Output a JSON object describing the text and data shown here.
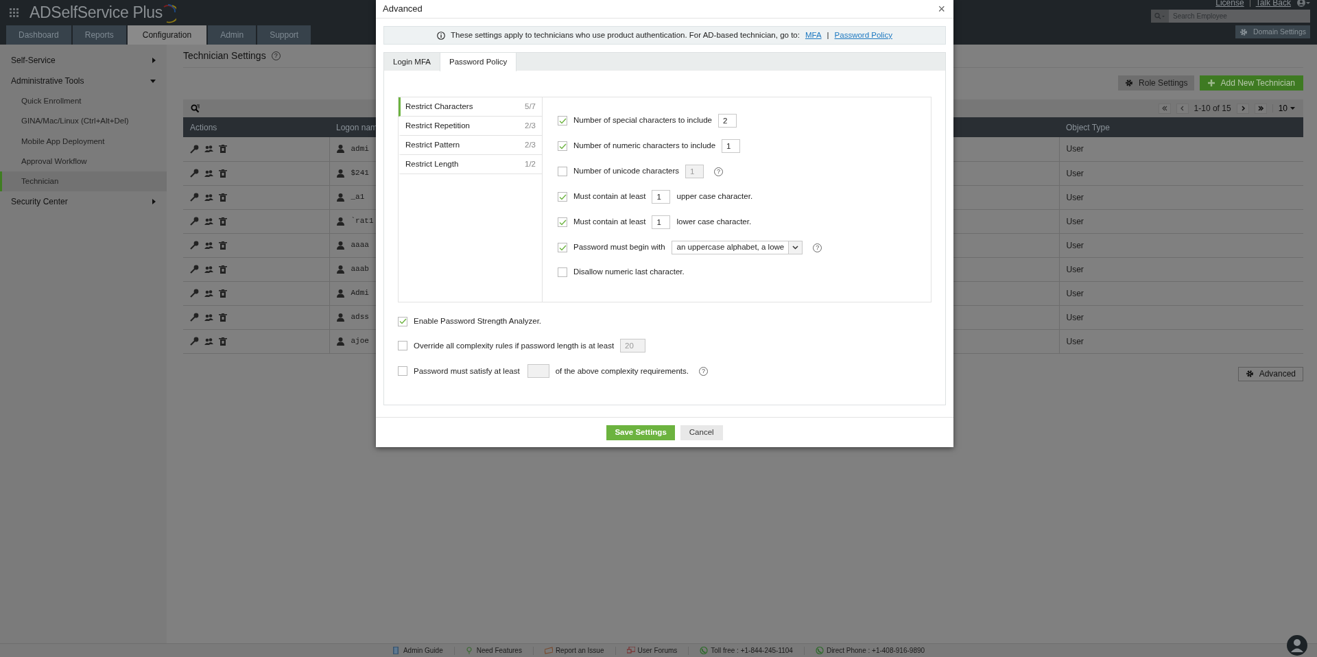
{
  "app": {
    "title": "ADSelfService Plus"
  },
  "header_links": [
    "License",
    "Talk Back"
  ],
  "search": {
    "placeholder": "Search Employee"
  },
  "domain_button": "Domain Settings",
  "main_tabs": [
    {
      "label": "Dashboard",
      "selected": false
    },
    {
      "label": "Reports",
      "selected": false
    },
    {
      "label": "Configuration",
      "selected": true
    },
    {
      "label": "Admin",
      "selected": false
    },
    {
      "label": "Support",
      "selected": false
    }
  ],
  "sidebar": {
    "items": [
      {
        "label": "Self-Service",
        "expanded": false
      },
      {
        "label": "Administrative Tools",
        "expanded": true,
        "children": [
          {
            "label": "Quick Enrollment",
            "selected": false
          },
          {
            "label": "GINA/Mac/Linux (Ctrl+Alt+Del)",
            "selected": false
          },
          {
            "label": "Mobile App Deployment",
            "selected": false
          },
          {
            "label": "Approval Workflow",
            "selected": false
          },
          {
            "label": "Technician",
            "selected": true
          }
        ]
      },
      {
        "label": "Security Center",
        "expanded": false
      }
    ]
  },
  "page": {
    "title": "Technician Settings",
    "help": "?",
    "buttons": [
      {
        "label": "Role Settings",
        "kind": "secondary"
      },
      {
        "label": "Add New Technician",
        "kind": "primary"
      }
    ]
  },
  "pagination": {
    "range": "1-10 of 15",
    "page_size": "10"
  },
  "table": {
    "columns": [
      "Actions",
      "Logon nam",
      "Object Type"
    ],
    "rows": [
      {
        "logon": "admi",
        "object_type": "User"
      },
      {
        "logon": "$241",
        "object_type": "User"
      },
      {
        "logon": "_a1",
        "object_type": "User"
      },
      {
        "logon": "`rat1",
        "object_type": "User"
      },
      {
        "logon": "aaaa",
        "object_type": "User"
      },
      {
        "logon": "aaab",
        "object_type": "User"
      },
      {
        "logon": "Admi",
        "object_type": "User"
      },
      {
        "logon": "adss",
        "object_type": "User"
      },
      {
        "logon": "ajoe",
        "object_type": "User"
      }
    ]
  },
  "advanced_button": "Advanced",
  "footer": [
    {
      "label": "Admin Guide",
      "kind": "guide"
    },
    {
      "label": "Need Features",
      "kind": "idea"
    },
    {
      "label": "Report an Issue",
      "kind": "issue"
    },
    {
      "label": "User Forums",
      "kind": "forum"
    },
    {
      "label": "Toll free : +1-844-245-1104",
      "kind": "phone"
    },
    {
      "label": "Direct Phone : +1-408-916-9890",
      "kind": "phone"
    }
  ],
  "modal": {
    "title": "Advanced",
    "close": "×",
    "info": {
      "text": "These settings apply to technicians who use product authentication. For AD-based technician, go to:",
      "links": [
        "MFA",
        "Password Policy"
      ],
      "separator": "|"
    },
    "tabs": [
      {
        "label": "Login MFA",
        "selected": false
      },
      {
        "label": "Password Policy",
        "selected": true
      }
    ],
    "categories": [
      {
        "label": "Restrict Characters",
        "count": "5/7",
        "selected": true
      },
      {
        "label": "Restrict Repetition",
        "count": "2/3",
        "selected": false
      },
      {
        "label": "Restrict Pattern",
        "count": "2/3",
        "selected": false
      },
      {
        "label": "Restrict Length",
        "count": "1/2",
        "selected": false
      }
    ],
    "rules": [
      {
        "kind": "number",
        "label": "Number of special characters to include",
        "value": "2",
        "checked": true
      },
      {
        "kind": "number",
        "label": "Number of numeric characters to include",
        "value": "1",
        "checked": true
      },
      {
        "kind": "number",
        "label": "Number of unicode characters",
        "value": "1",
        "checked": false,
        "help": "?"
      },
      {
        "kind": "between",
        "label": "Must contain at least",
        "value": "1",
        "after": "upper case character.",
        "checked": true
      },
      {
        "kind": "between",
        "label": "Must contain at least",
        "value": "1",
        "after": "lower case character.",
        "checked": true
      },
      {
        "kind": "select",
        "label": "Password must begin with",
        "value": "an uppercase alphabet, a lowe",
        "checked": true,
        "help": "?"
      },
      {
        "kind": "plain",
        "label": "Disallow numeric last character.",
        "checked": false
      }
    ],
    "options": [
      {
        "kind": "plain",
        "label": "Enable Password Strength Analyzer.",
        "checked": true
      },
      {
        "kind": "number",
        "label": "Override all complexity rules if password length is at least",
        "value": "20",
        "checked": false
      },
      {
        "kind": "between",
        "label": "Password must satisfy at least",
        "after": "of the above complexity requirements.",
        "checked": false,
        "help": "?"
      }
    ],
    "buttons": [
      {
        "label": "Save Settings",
        "kind": "primary"
      },
      {
        "label": "Cancel",
        "kind": "secondary"
      }
    ]
  }
}
